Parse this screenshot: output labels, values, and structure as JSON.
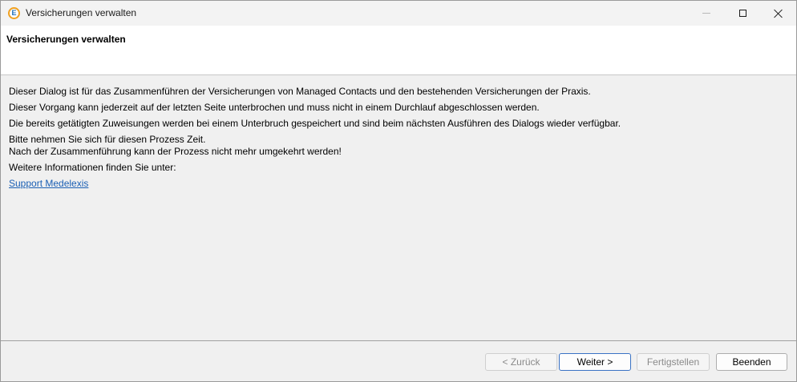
{
  "window": {
    "title": "Versicherungen verwalten",
    "app_icon_letter": "E"
  },
  "header": {
    "title": "Versicherungen verwalten"
  },
  "content": {
    "lines": [
      "Dieser Dialog ist für das Zusammenführen der Versicherungen von Managed Contacts und den bestehenden Versicherungen der Praxis.",
      "Dieser Vorgang kann jederzeit auf der letzten Seite unterbrochen und muss nicht in einem Durchlauf abgeschlossen werden.",
      "Die bereits getätigten Zuweisungen werden bei einem Unterbruch gespeichert und sind beim nächsten Ausführen des Dialogs wieder verfügbar.",
      "Bitte nehmen Sie sich für diesen Prozess Zeit.",
      "Nach der Zusammenführung kann der Prozess nicht mehr umgekehrt werden!",
      "Weitere Informationen finden Sie unter:"
    ],
    "link_label": "Support Medelexis"
  },
  "buttons": {
    "back": "< Zurück",
    "next": "Weiter >",
    "finish": "Fertigstellen",
    "cancel": "Beenden"
  },
  "colors": {
    "link": "#1a5fb4",
    "default_button_border": "#3a72c4",
    "background": "#f0f0f0"
  }
}
